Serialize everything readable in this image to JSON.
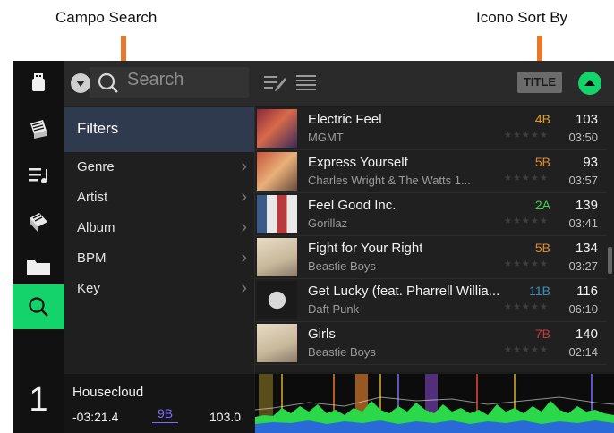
{
  "callouts": {
    "search_field": "Campo Search",
    "sort_icon": "Icono Sort By"
  },
  "toolbar": {
    "search_placeholder": "Search",
    "sort_label": "TITLE"
  },
  "sidebar": {
    "filters_label": "Filters",
    "items": [
      {
        "label": "Genre"
      },
      {
        "label": "Artist"
      },
      {
        "label": "Album"
      },
      {
        "label": "BPM"
      },
      {
        "label": "Key"
      }
    ]
  },
  "deck": {
    "number": "1",
    "track": "Housecloud",
    "time_remaining": "-03:21.4",
    "key": "9B",
    "bpm": "103.0"
  },
  "tracks": [
    {
      "title": "Electric Feel",
      "artist": "MGMT",
      "key": "4B",
      "key_color": "#d8a21f",
      "bpm": "103",
      "time": "03:50"
    },
    {
      "title": "Express Yourself",
      "artist": "Charles Wright & The Watts 1...",
      "key": "5B",
      "key_color": "#e08a2a",
      "bpm": "93",
      "time": "03:57"
    },
    {
      "title": "Feel Good Inc.",
      "artist": "Gorillaz",
      "key": "2A",
      "key_color": "#3fd34b",
      "bpm": "139",
      "time": "03:41"
    },
    {
      "title": "Fight for Your Right",
      "artist": "Beastie Boys",
      "key": "5B",
      "key_color": "#e08a2a",
      "bpm": "134",
      "time": "03:27"
    },
    {
      "title": "Get Lucky (feat. Pharrell Willia...",
      "artist": "Daft Punk",
      "key": "11B",
      "key_color": "#3a8fb8",
      "bpm": "116",
      "time": "06:10"
    },
    {
      "title": "Girls",
      "artist": "Beastie Boys",
      "key": "7B",
      "key_color": "#c83a3a",
      "bpm": "140",
      "time": "02:14"
    }
  ],
  "colors": {
    "accent_green": "#15d36b",
    "callout_arrow": "#e8782c",
    "filters_highlight": "#2f3a4f",
    "deck_key_purple": "#7c6cff"
  },
  "icons": [
    "usb-drive-icon",
    "crates-icon",
    "playlist-icon",
    "prepare-icon",
    "folder-icon",
    "search-icon",
    "chevron-down-icon",
    "edit-list-icon",
    "list-icon",
    "arrow-up-icon",
    "chevron-right-icon"
  ]
}
